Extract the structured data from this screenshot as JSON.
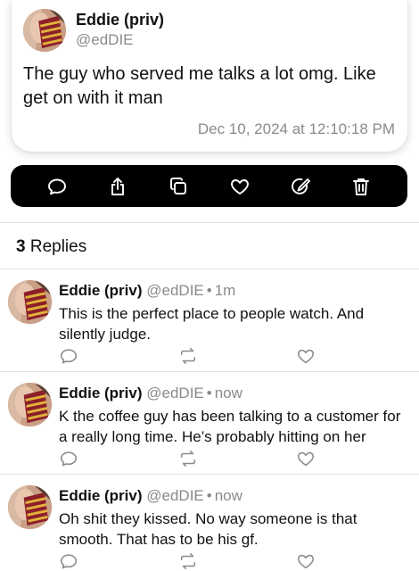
{
  "post": {
    "author_name": "Eddie (priv)",
    "author_handle": "@edDIE",
    "text": "The guy who served me talks a lot omg. Like get on with it man",
    "timestamp": "Dec 10, 2024 at 12:10:18 PM"
  },
  "action_bar": {
    "icons": [
      "comment-icon",
      "share-icon",
      "copy-icon",
      "heart-icon",
      "edit-icon",
      "trash-icon"
    ],
    "background": "#000000",
    "icon_color": "#ffffff"
  },
  "replies_header": {
    "count": "3",
    "label": "Replies"
  },
  "replies": [
    {
      "name": "Eddie (priv)",
      "handle": "@edDIE",
      "separator": "•",
      "time": "1m",
      "text": "This is the perfect place to people watch. And silently judge."
    },
    {
      "name": "Eddie (priv)",
      "handle": "@edDIE",
      "separator": "•",
      "time": "now",
      "text": "K the coffee guy has been talking to a customer for a really long time. He’s probably hitting on her"
    },
    {
      "name": "Eddie (priv)",
      "handle": "@edDIE",
      "separator": "•",
      "time": "now",
      "text": "Oh shit they kissed. No way someone is that smooth. That has to be his gf."
    }
  ],
  "colors": {
    "secondary_text": "#8a8a8e",
    "divider": "#e3e3e6"
  }
}
